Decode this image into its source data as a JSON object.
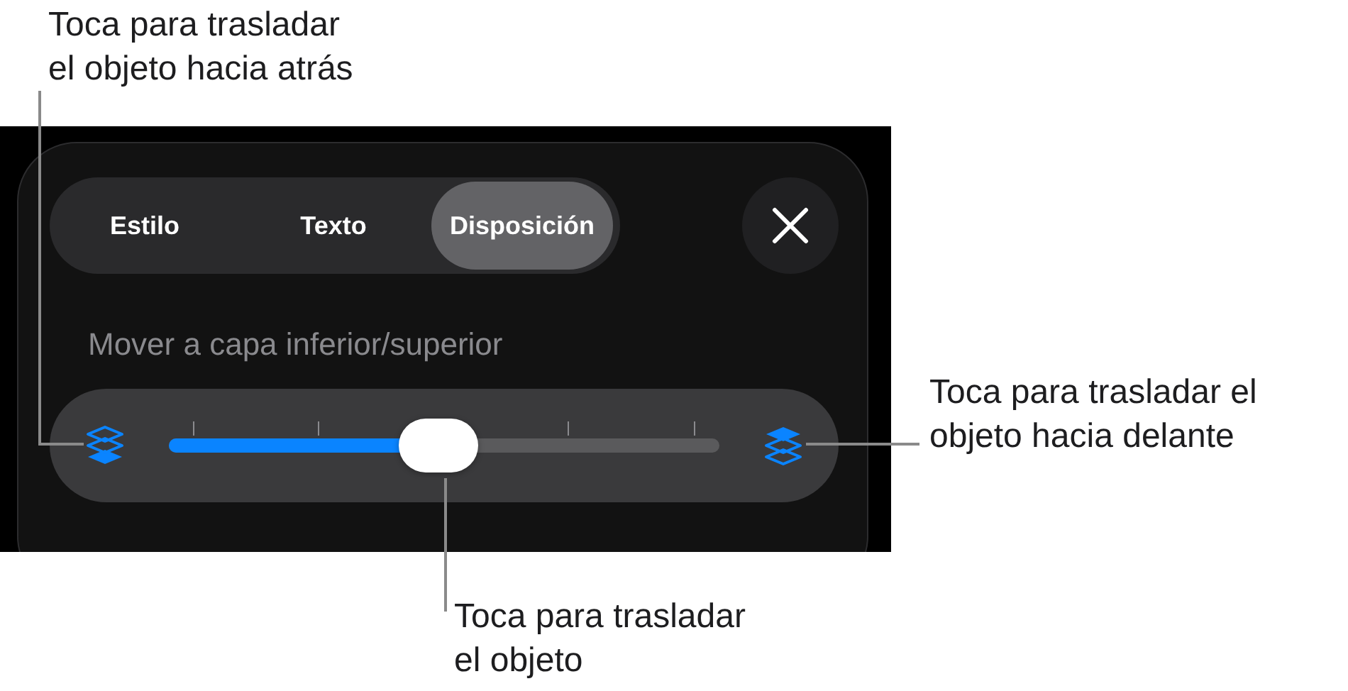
{
  "callouts": [
    {
      "kind": "back",
      "text": "Toca para trasladar\nel objeto hacia atrás"
    },
    {
      "kind": "front",
      "text": "Toca para trasladar el\nobjeto hacia delante"
    },
    {
      "kind": "slider",
      "text": "Toca para trasladar\nel objeto"
    }
  ],
  "tabs": [
    {
      "label": "Estilo",
      "selected": false
    },
    {
      "label": "Texto",
      "selected": false
    },
    {
      "label": "Disposición",
      "selected": true
    }
  ],
  "section_label": "Mover a capa inferior/superior",
  "slider": {
    "level": 0.49
  }
}
